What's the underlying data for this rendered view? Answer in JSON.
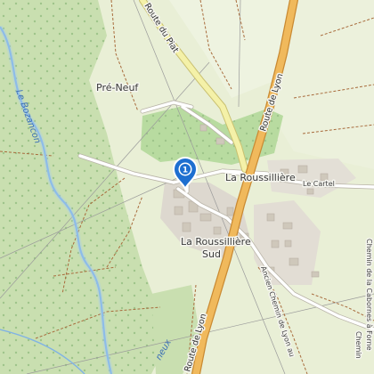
{
  "map": {
    "labels": {
      "pre_neuf": "Pré-Neuf",
      "route_du_piat": "Route du Piat",
      "route_de_lyon_n": "Route de Lyon",
      "route_de_lyon_s": "Route de Lyon",
      "la_roussilliere": "La Roussillière",
      "le_cartel": "Le Cartel",
      "la_roussilliere_sud_1": "La Roussillière",
      "la_roussilliere_sud_2": "Sud",
      "le_bozancon": "Le Bozancon",
      "ancien_chemin": "Ancien Chemin de Lyon au",
      "chemin_cabornes_1": "Chemin de la Cabornes à Forne",
      "chemin_cabornes_2": "Chemin",
      "ruisseau": "neux"
    },
    "marker": {
      "number": "1",
      "color": "#1e6fd0",
      "icon": "map-pin-icon"
    },
    "colors": {
      "meadow": "#e9efd6",
      "forest": "#c9dfb0",
      "field": "#dcecc4",
      "road_major": "#f0b95c",
      "road_secondary": "#f4f1a8",
      "water": "#7fb2e5",
      "building": "#d4cfc5"
    }
  }
}
